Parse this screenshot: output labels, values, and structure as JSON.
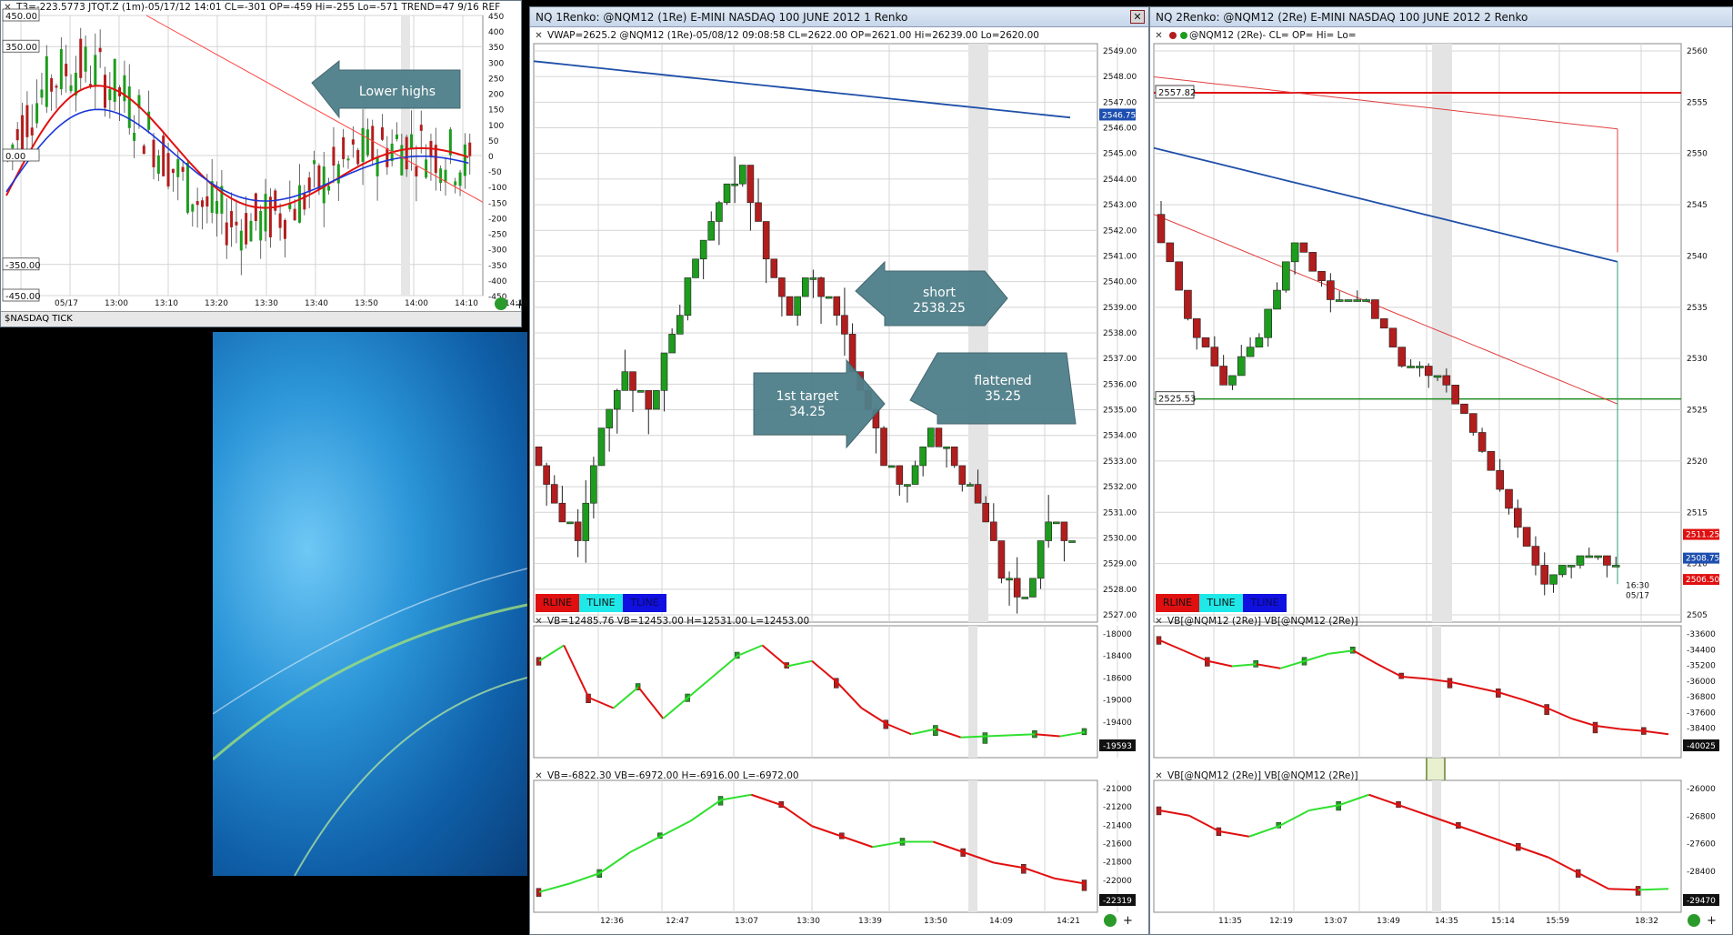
{
  "colors": {
    "up": "#1d9c1d",
    "down": "#b21d1d",
    "vwap": "#1f4fa8",
    "trend": "#e02020",
    "callout": "#4f7f8a",
    "grid": "#d4d4d4"
  },
  "tick_window": {
    "header": "T3=-223.5773  JTQT.Z (1m)-05/17/12 14:01 CL=-301 OP=-459 Hi=-255 Lo=-571  TREND=47 9/16  REF",
    "levels": {
      "top": "450.00",
      "mid_high": "350.00",
      "zero": "0.00",
      "mid_low": "-350.00",
      "bottom": "-450.00"
    },
    "y_ticks": [
      "450",
      "400",
      "350",
      "300",
      "250",
      "200",
      "150",
      "100",
      "50",
      "0",
      "-50",
      "-100",
      "-150",
      "-200",
      "-250",
      "-300",
      "-350",
      "-400",
      "-450"
    ],
    "x_ticks": [
      "05/17",
      "13:00",
      "13:10",
      "13:20",
      "13:30",
      "13:40",
      "13:50",
      "14:00",
      "14:10",
      "14:18"
    ],
    "tab_label": "$NASDAQ TICK",
    "callout": "Lower highs"
  },
  "renko1": {
    "title": "NQ 1Renko: @NQM12 (1Re) E-MINI NASDAQ 100 JUNE 2012 1 Renko",
    "header": "VWAP=2625.2  @NQM12 (1Re)-05/08/12 09:08:58 CL=2622.00 OP=2621.00 Hi=26239.00 Lo=2620.00",
    "y_ticks": [
      "2549.00",
      "2548.00",
      "2547.00",
      "2546.00",
      "2545.00",
      "2544.00",
      "2543.00",
      "2542.00",
      "2541.00",
      "2540.00",
      "2539.00",
      "2538.00",
      "2537.00",
      "2536.00",
      "2535.00",
      "2534.00",
      "2533.00",
      "2532.00",
      "2531.00",
      "2530.00",
      "2529.00",
      "2528.00",
      "2527.00"
    ],
    "vwap_label": "2546.75",
    "legend": [
      "RLINE",
      "TLINE",
      "TLINE"
    ],
    "callouts": {
      "short": "short\n2538.25",
      "target": "1st target\n34.25",
      "flat": "flattened\n35.25"
    },
    "vb1_header": "VB=12485.76  VB=12453.00 H=12531.00 L=12453.00",
    "vb1_ticks": [
      "-18000",
      "-18400",
      "-18600",
      "-19000",
      "-19400",
      "-19800"
    ],
    "vb1_value": "-19593",
    "vb2_header": "VB=-6822.30  VB=-6972.00 H=-6916.00 L=-6972.00",
    "vb2_ticks": [
      "-21000",
      "-21200",
      "-21400",
      "-21600",
      "-21800",
      "-22000",
      "-22200"
    ],
    "vb2_value": "-22319",
    "x_ticks": [
      "12:36",
      "12:47",
      "13:07",
      "13:30",
      "13:39",
      "13:50",
      "14:09",
      "14:21"
    ]
  },
  "renko2": {
    "title": "NQ 2Renko: @NQM12 (2Re) E-MINI NASDAQ 100 JUNE 2012 2 Renko",
    "header": "@NQM12 (2Re)- CL= OP= Hi= Lo=",
    "y_ticks": [
      "2560",
      "2555",
      "2550",
      "2545",
      "2540",
      "2535",
      "2530",
      "2525",
      "2520",
      "2515",
      "2510",
      "2505"
    ],
    "red_level": "2557.82",
    "green_level": "2525.53",
    "price_labels": {
      "upper": "2511.25",
      "mid": "2508.75",
      "lower": "2506.50"
    },
    "date_label": "16:30\n05/17",
    "legend": [
      "RLINE",
      "TLINE",
      "TLINE"
    ],
    "vb1_header": "VB[@NQM12 (2Re)]  VB[@NQM12 (2Re)]",
    "vb1_ticks": [
      "-33600",
      "-34400",
      "-35200",
      "-36000",
      "-36800",
      "-37600",
      "-38400",
      "-39200"
    ],
    "vb1_value": "-40025",
    "vb2_header": "VB[@NQM12 (2Re)]  VB[@NQM12 (2Re)]",
    "vb2_ticks": [
      "-26000",
      "-26800",
      "-27600",
      "-28400",
      "-29200"
    ],
    "vb2_value": "-29470",
    "x_ticks": [
      "11:35",
      "12:19",
      "13:07",
      "13:49",
      "14:35",
      "15:14",
      "15:59",
      "18:32"
    ]
  }
}
